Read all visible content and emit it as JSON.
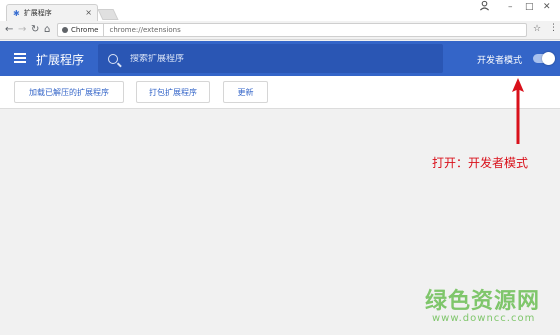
{
  "tab": {
    "title": "扩展程序",
    "close": "×"
  },
  "window": {
    "minimize": "–",
    "maximize": "□",
    "close": "✕"
  },
  "omnibox": {
    "site_label": "Chrome",
    "url": "chrome://extensions"
  },
  "header": {
    "title": "扩展程序",
    "search_placeholder": "搜索扩展程序",
    "devmode_label": "开发者模式",
    "devmode_on": true,
    "accent": "#3465c8"
  },
  "actions": {
    "load_unpacked": "加载已解压的扩展程序",
    "pack": "打包扩展程序",
    "update": "更新"
  },
  "annotation": {
    "text": "打开：开发者模式",
    "color": "#d9111b"
  },
  "watermark": {
    "main": "绿色资源网",
    "sub": "www.downcc.com"
  }
}
